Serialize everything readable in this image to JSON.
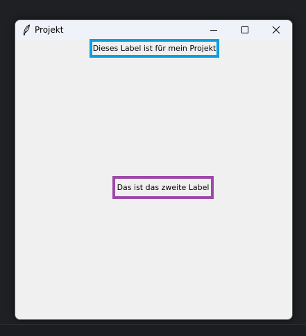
{
  "window": {
    "title": "Projekt",
    "icon": "feather-icon",
    "controls": {
      "minimize": "minimize-icon",
      "maximize": "maximize-icon",
      "close": "close-icon"
    }
  },
  "labels": {
    "first": "Dieses Label ist für mein Projekt",
    "second": "Das ist das zweite Label"
  },
  "colors": {
    "first_label_border": "#0a9ee0",
    "second_label_border": "#9d4aa9",
    "window_background": "#f0f0f0",
    "titlebar_background": "#eff3f9"
  }
}
